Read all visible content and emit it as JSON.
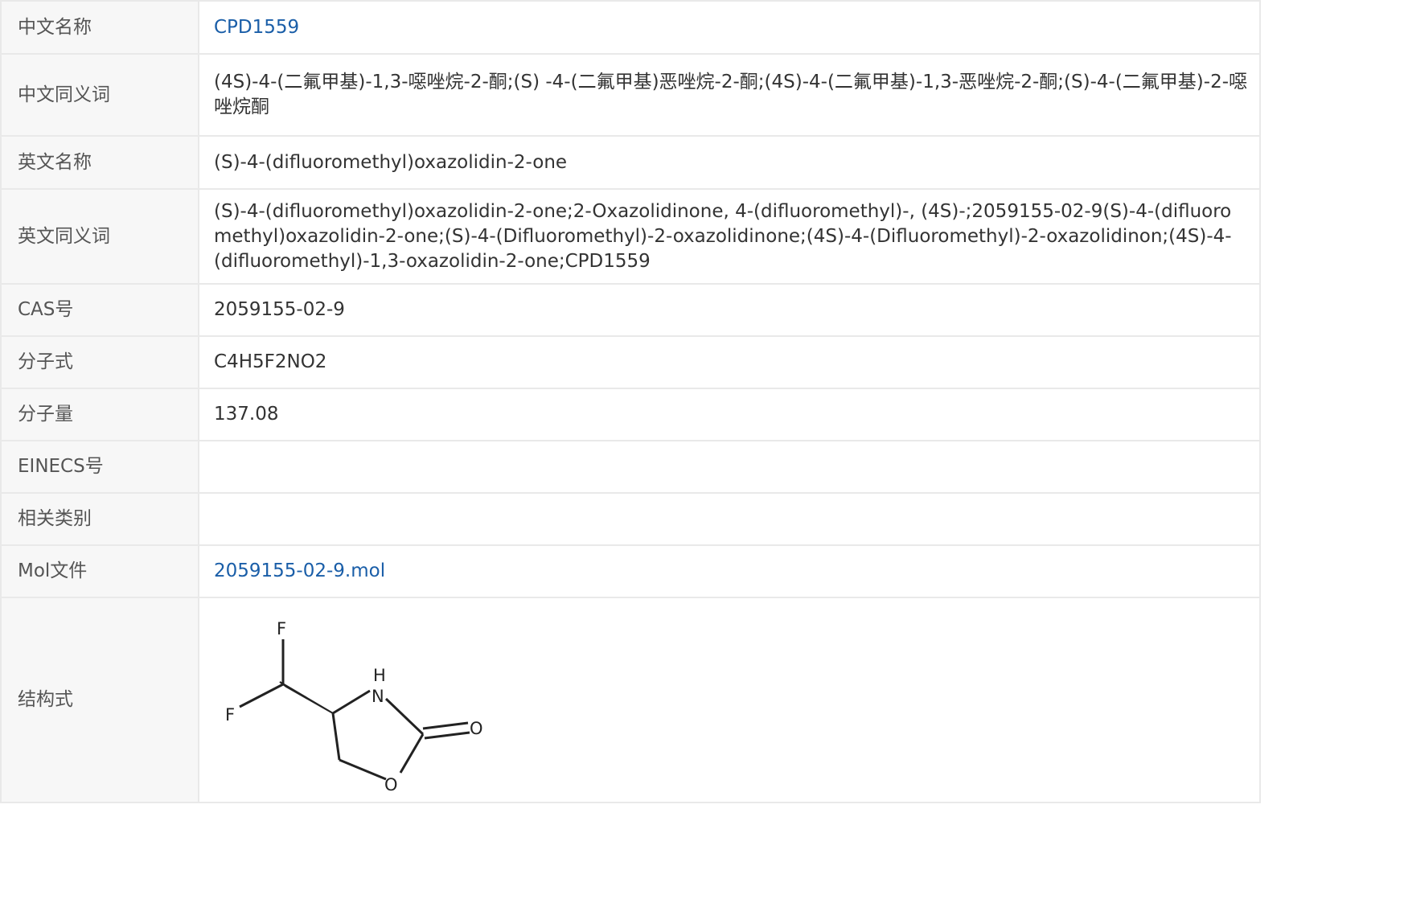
{
  "rows": [
    {
      "label": "中文名称",
      "value": "CPD1559",
      "link": true
    },
    {
      "label": "中文同义词",
      "value": "(4S)-4-(二氟甲基)-1,3-噁唑烷-2-酮;(S) -4-(二氟甲基)恶唑烷-2-酮;(4S)-4-(二氟甲基)-1,3-恶唑烷-2-酮;(S)-4-(二氟甲基)-2-噁唑烷酮"
    },
    {
      "label": "英文名称",
      "value": "(S)-4-(difluoromethyl)oxazolidin-2-one"
    },
    {
      "label": "英文同义词",
      "value": "(S)-4-(difluoromethyl)oxazolidin-2-one;2-Oxazolidinone, 4-(difluoromethyl)-, (4S)-;2059155-02-9(S)-4-(difluoromethyl)oxazolidin-2-one;(S)-4-(Difluoromethyl)-2-oxazolidinone;(4S)-4-(Difluoromethyl)-2-oxazolidinon;(4S)-4-(difluoromethyl)-1,3-oxazolidin-2-one;CPD1559"
    },
    {
      "label": "CAS号",
      "value": "2059155-02-9"
    },
    {
      "label": "分子式",
      "value": "C4H5F2NO2"
    },
    {
      "label": "分子量",
      "value": "137.08"
    },
    {
      "label": "EINECS号",
      "value": ""
    },
    {
      "label": "相关类别",
      "value": ""
    },
    {
      "label": "Mol文件",
      "value": "2059155-02-9.mol",
      "link": true
    },
    {
      "label": "结构式",
      "value": ""
    }
  ],
  "structure": {
    "atoms": {
      "f_top": "F",
      "f_left": "F",
      "nh_h": "H",
      "nh_n": "N",
      "o_carbonyl": "O",
      "o_ring": "O"
    }
  },
  "colors": {
    "link": "#1a5ea8",
    "label_bg": "#f7f7f7",
    "border": "#e9e9e9",
    "text": "#333333"
  }
}
